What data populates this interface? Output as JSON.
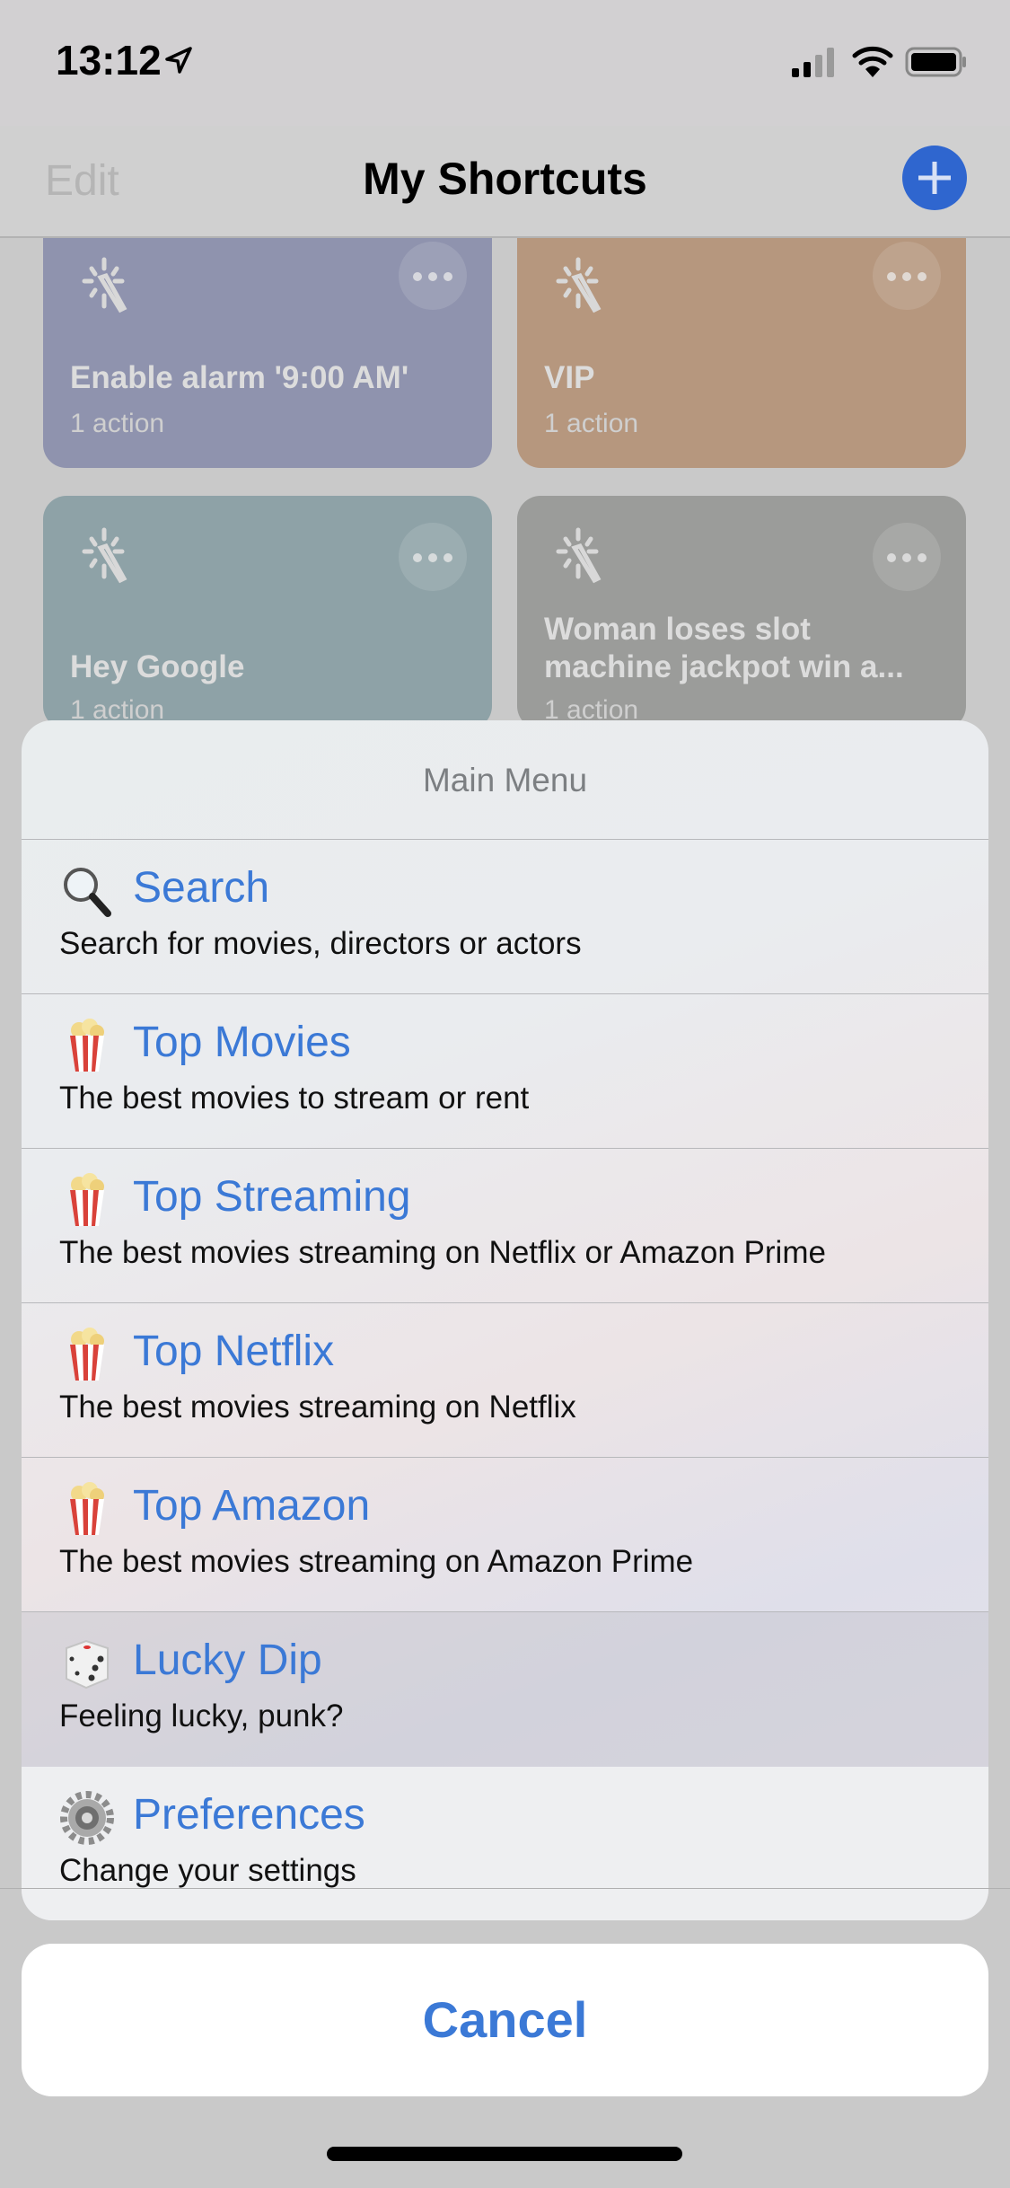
{
  "status_bar": {
    "time": "13:12",
    "icons": [
      "location-arrow-icon",
      "cellular-signal-icon",
      "wifi-icon",
      "battery-icon"
    ]
  },
  "nav": {
    "edit_label": "Edit",
    "title": "My Shortcuts",
    "add_icon": "plus-icon"
  },
  "shortcuts": [
    {
      "name": "Enable alarm '9:00 AM'",
      "count": "1 action",
      "color": "#8f93ae"
    },
    {
      "name": "VIP",
      "count": "1 action",
      "color": "#b6977e"
    },
    {
      "name": "Hey Google",
      "count": "1 action",
      "color": "#8ea2a7"
    },
    {
      "name": "Woman loses slot machine jackpot win a...",
      "count": "1 action",
      "color": "#9b9c9a"
    }
  ],
  "sheet": {
    "title": "Main Menu",
    "items": [
      {
        "icon": "magnifying-glass-icon",
        "label": "Search",
        "subtitle": "Search for movies, directors or actors"
      },
      {
        "icon": "popcorn-icon",
        "label": "Top Movies",
        "subtitle": "The best movies to stream or rent"
      },
      {
        "icon": "popcorn-icon",
        "label": "Top Streaming",
        "subtitle": "The best movies streaming on Netflix or Amazon Prime"
      },
      {
        "icon": "popcorn-icon",
        "label": "Top Netflix",
        "subtitle": "The best movies streaming on Netflix"
      },
      {
        "icon": "popcorn-icon",
        "label": "Top Amazon",
        "subtitle": "The best movies streaming on Amazon Prime"
      },
      {
        "icon": "dice-icon",
        "label": "Lucky Dip",
        "subtitle": "Feeling lucky, punk?"
      },
      {
        "icon": "gear-icon",
        "label": "Preferences",
        "subtitle": "Change your settings"
      }
    ],
    "cancel_label": "Cancel"
  },
  "colors": {
    "accent": "#3b79d6",
    "add_button": "#2f66cf"
  }
}
